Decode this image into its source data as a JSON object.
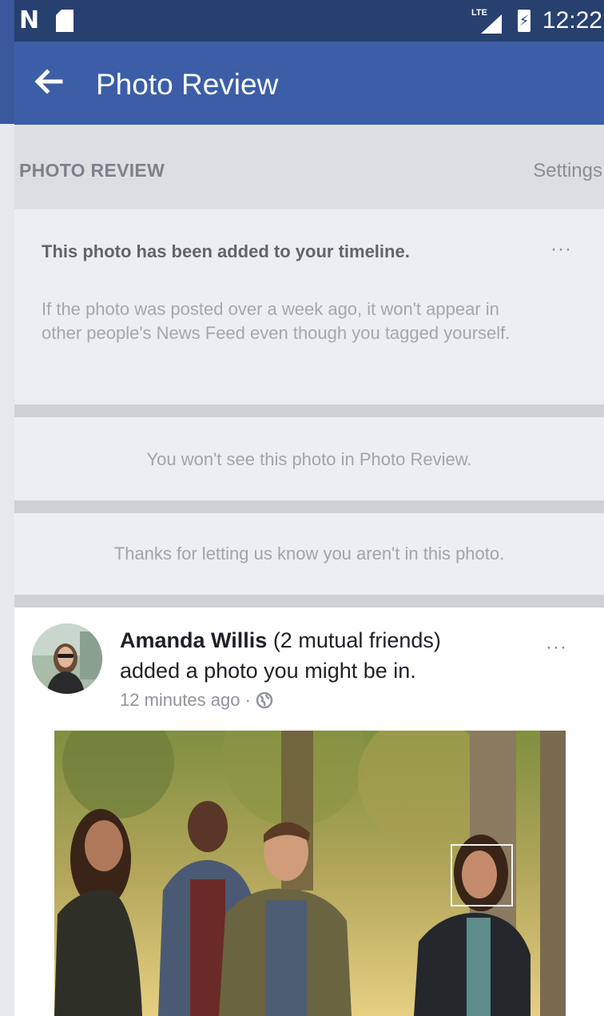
{
  "status_bar": {
    "time": "12:22",
    "network_label": "LTE",
    "icons": [
      "notification-n-icon",
      "sd-card-icon",
      "lte-signal-icon",
      "battery-charging-icon"
    ]
  },
  "app_bar": {
    "title": "Photo Review",
    "back_icon": "back-arrow-icon",
    "color": "#3b5ea7"
  },
  "section": {
    "title": "PHOTO REVIEW",
    "settings_label": "Settings"
  },
  "timeline_card": {
    "title": "This photo has been added to your timeline.",
    "body": "If the photo was posted over a week ago, it won't appear in other people's News Feed even though you tagged yourself.",
    "more_label": "···"
  },
  "notice_card": {
    "text": "You won't see this photo in Photo Review."
  },
  "thanks_card": {
    "text": "Thanks for letting us know you aren't in this photo."
  },
  "post": {
    "author": "Amanda Willis",
    "mutual_friends": "(2 mutual friends)",
    "action": "added a photo you might be in.",
    "time": "12 minutes ago",
    "separator": "·",
    "privacy_icon": "globe-icon",
    "more_label": "···"
  }
}
